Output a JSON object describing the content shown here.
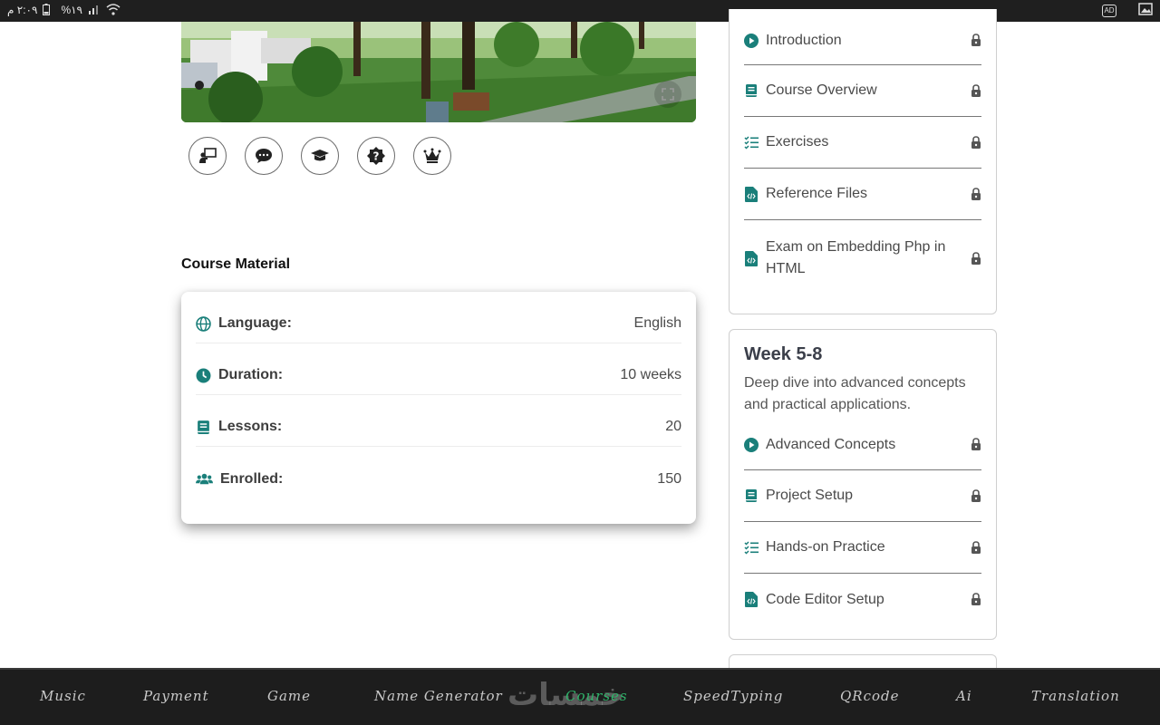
{
  "statusbar": {
    "time_text": "٢:٠٩ م",
    "battery_text": "%١٩",
    "right_icons": [
      "ad-icon",
      "image-icon"
    ],
    "ad_text": "AD"
  },
  "video": {
    "thumbnail": "park-scene",
    "fullscreen_icon": "expand-icon"
  },
  "action_buttons": [
    {
      "name": "teacher-icon"
    },
    {
      "name": "chat-icon"
    },
    {
      "name": "graduation-cap-icon"
    },
    {
      "name": "help-icon"
    },
    {
      "name": "crown-icon"
    }
  ],
  "course_material": {
    "title": "Course Material",
    "rows": [
      {
        "icon": "globe-icon",
        "label": "Language:",
        "value": "English"
      },
      {
        "icon": "clock-icon",
        "label": "Duration:",
        "value": "10 weeks"
      },
      {
        "icon": "book-icon",
        "label": "Lessons:",
        "value": "20"
      },
      {
        "icon": "users-icon",
        "label": "Enrolled:",
        "value": "150"
      }
    ]
  },
  "week1": {
    "lessons": [
      {
        "icon": "play-icon",
        "label": "Introduction"
      },
      {
        "icon": "book-icon",
        "label": "Course Overview"
      },
      {
        "icon": "checklist-icon",
        "label": "Exercises"
      },
      {
        "icon": "code-file-icon",
        "label": "Reference Files"
      },
      {
        "icon": "code-file-icon",
        "label": "Exam on Embedding Php in HTML"
      }
    ]
  },
  "week2": {
    "title": "Week 5-8",
    "description": "Deep dive into advanced concepts and practical applications.",
    "lessons": [
      {
        "icon": "play-icon",
        "label": "Advanced Concepts"
      },
      {
        "icon": "book-icon",
        "label": "Project Setup"
      },
      {
        "icon": "checklist-icon",
        "label": "Hands-on Practice"
      },
      {
        "icon": "code-file-icon",
        "label": "Code Editor Setup"
      }
    ]
  },
  "bottom_nav": {
    "items": [
      "Music",
      "Payment",
      "Game",
      "Name Generator",
      "Courses",
      "SpeedTyping",
      "QRcode",
      "Ai",
      "Translation"
    ],
    "active": "Courses",
    "watermark": "خمسات"
  },
  "colors": {
    "accent": "#1a7f7a",
    "nav_active": "#2fb36a",
    "nav_bg": "#1d1d1d"
  }
}
